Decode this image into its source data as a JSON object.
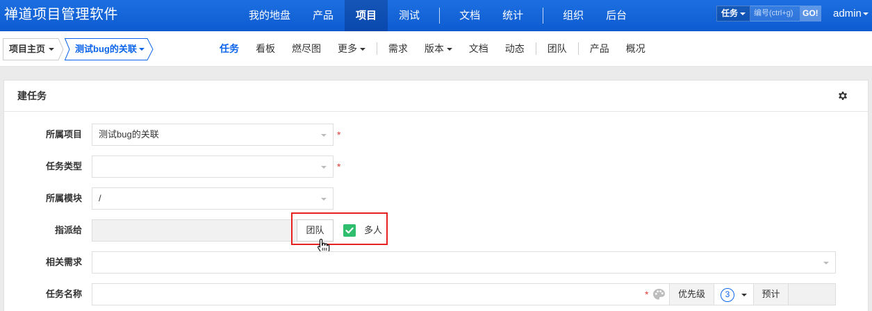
{
  "app": {
    "brand": "禅道项目管理软件",
    "main_nav": [
      "我的地盘",
      "产品",
      "项目",
      "测试",
      "文档",
      "统计",
      "组织",
      "后台"
    ],
    "active_main_nav": "项目",
    "search": {
      "type": "任务",
      "placeholder": "编号(ctrl+g)",
      "go": "GO!"
    },
    "user": "admin"
  },
  "breadcrumb": {
    "home": "项目主页",
    "current": "测试bug的关联"
  },
  "sub_nav": [
    "任务",
    "看板",
    "燃尽图",
    "更多",
    "需求",
    "版本",
    "文档",
    "动态",
    "团队",
    "产品",
    "概况"
  ],
  "active_sub_nav": "任务",
  "panel": {
    "title": "建任务",
    "settings_icon": "gear-icon"
  },
  "form": {
    "project": {
      "label": "所属项目",
      "value": "测试bug的关联",
      "required": "*"
    },
    "task_type": {
      "label": "任务类型",
      "value": "",
      "required": "*"
    },
    "module": {
      "label": "所属模块",
      "value": "/"
    },
    "assign_to": {
      "label": "指派给",
      "team_button": "团队",
      "multi_label": "多人",
      "multi_checked": true
    },
    "story": {
      "label": "相关需求",
      "value": ""
    },
    "name": {
      "label": "任务名称",
      "value": "",
      "required": "*",
      "priority_label": "优先级",
      "priority_value": "3",
      "estimate_label": "预计"
    }
  },
  "colors": {
    "topbar": "#1466dd",
    "accent": "#0c64eb",
    "check": "#2fbd6e",
    "highlight": "#e82020",
    "required": "#e0403a"
  }
}
